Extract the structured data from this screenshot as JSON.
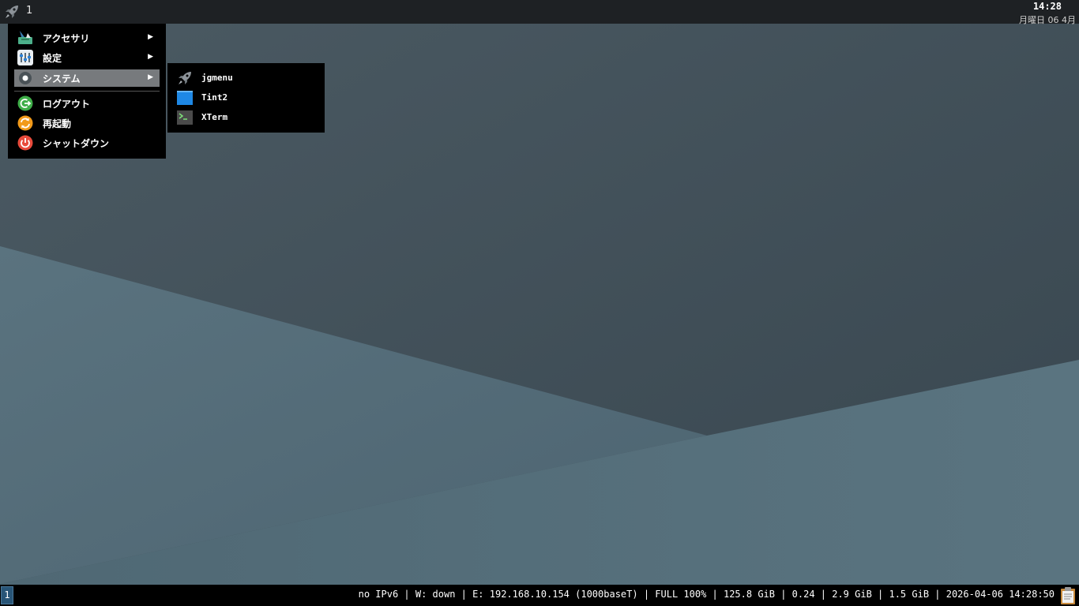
{
  "top_panel": {
    "workspace": "1",
    "clock_time": "14:28",
    "clock_date": "月曜日 06 4月"
  },
  "main_menu": {
    "items": [
      {
        "label": "アクセサリ",
        "icon": "accessories-icon",
        "has_submenu": true
      },
      {
        "label": "設定",
        "icon": "settings-icon",
        "has_submenu": true
      },
      {
        "label": "システム",
        "icon": "system-icon",
        "has_submenu": true,
        "active": true
      },
      {
        "label": "ログアウト",
        "icon": "logout-icon",
        "has_submenu": false
      },
      {
        "label": "再起動",
        "icon": "reboot-icon",
        "has_submenu": false
      },
      {
        "label": "シャットダウン",
        "icon": "shutdown-icon",
        "has_submenu": false
      }
    ],
    "arrow_glyph": "▶"
  },
  "sub_menu": {
    "items": [
      {
        "label": "jgmenu",
        "icon": "rocket-icon"
      },
      {
        "label": "Tint2",
        "icon": "tint2-icon"
      },
      {
        "label": "XTerm",
        "icon": "terminal-icon"
      }
    ]
  },
  "bottom_bar": {
    "workspace": "1",
    "status": "no IPv6 | W: down | E: 192.168.10.154 (1000baseT) | FULL 100% | 125.8 GiB | 0.24 | 2.9 GiB | 1.5 GiB | 2026-04-06 14:28:50"
  },
  "colors": {
    "panel_bg": "#1e2124",
    "menu_bg": "#000000",
    "menu_active": "#777a7d",
    "workspace_active": "#285577",
    "wallpaper_dark": "#3e4d57",
    "wallpaper_light": "#56707d"
  }
}
